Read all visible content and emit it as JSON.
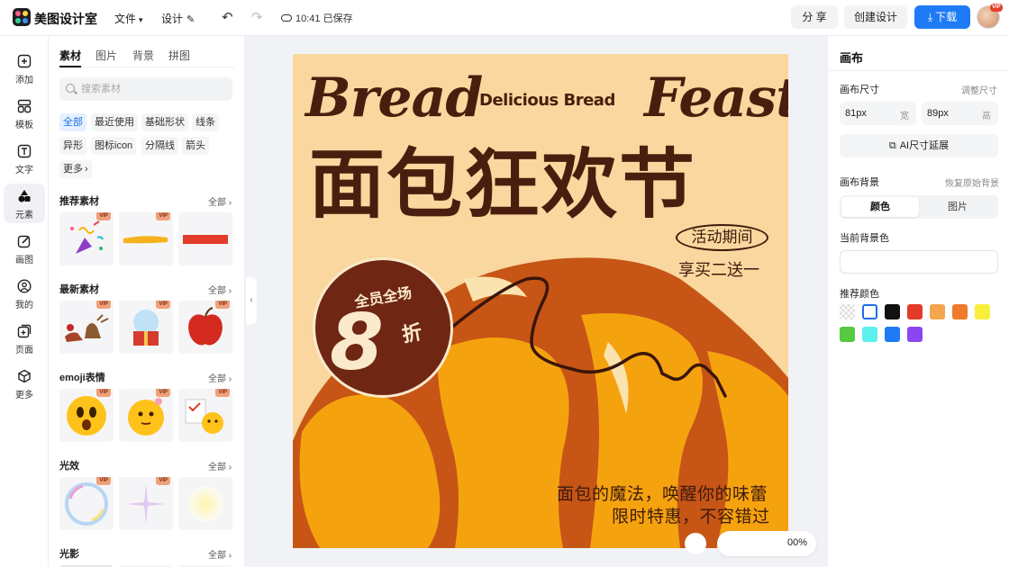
{
  "app": {
    "brand": "美图设计室",
    "save_status": "10:41 已保存"
  },
  "menu": {
    "file": "文件",
    "design": "设计"
  },
  "actions": {
    "share": "分 享",
    "create": "创建设计",
    "download": "下载",
    "avatar_badge": "VIP"
  },
  "rail": [
    {
      "label": "添加",
      "icon": "plus-icon"
    },
    {
      "label": "模板",
      "icon": "template-icon"
    },
    {
      "label": "文字",
      "icon": "text-icon"
    },
    {
      "label": "元素",
      "icon": "element-icon"
    },
    {
      "label": "画图",
      "icon": "draw-icon"
    },
    {
      "label": "我的",
      "icon": "user-icon"
    },
    {
      "label": "页面",
      "icon": "page-icon"
    },
    {
      "label": "更多",
      "icon": "cube-icon"
    }
  ],
  "panel": {
    "tabs": [
      "素材",
      "图片",
      "背景",
      "拼图"
    ],
    "search_placeholder": "搜索素材",
    "chips": [
      "全部",
      "最近使用",
      "基础形状",
      "线条",
      "异形",
      "图标icon",
      "分隔线",
      "箭头",
      "更多"
    ],
    "sections": [
      {
        "title": "推荐素材",
        "all": "全部"
      },
      {
        "title": "最新素材",
        "all": "全部"
      },
      {
        "title": "emoji表情",
        "all": "全部"
      },
      {
        "title": "光效",
        "all": "全部"
      },
      {
        "title": "光影",
        "all": "全部"
      }
    ],
    "vip": "VIP"
  },
  "poster": {
    "bread": "Bread",
    "feast": "Feast",
    "delicious": "Delicious Bread",
    "main_title": "面包狂欢节",
    "period": "活动期间",
    "offer": "享买二送一",
    "badge_top": "全员全场",
    "badge_num": "8",
    "badge_unit": "折",
    "slogan1": "面包的魔法，唤醒你的味蕾",
    "slogan2": "限时特惠，不容错过",
    "colors": {
      "background": "#f9d79e",
      "dark_brown": "#4a1e0e",
      "orange": "#f5a20f",
      "rust": "#c65516"
    }
  },
  "zoom": "00%",
  "right": {
    "title": "画布",
    "size_label": "画布尺寸",
    "adjust_link": "调整尺寸",
    "width_value": "81px",
    "width_unit": "宽",
    "height_value": "89px",
    "height_unit": "高",
    "ai_button": "AI尺寸延展",
    "bg_label": "画布背景",
    "restore_link": "恢复原始背景",
    "seg": [
      "颜色",
      "图片"
    ],
    "current_bg_label": "当前背景色",
    "recommended_label": "推荐颜色",
    "swatches": [
      "transparent",
      "#ffffff",
      "#111111",
      "#e23b2a",
      "#f4a54e",
      "#ee7a2a",
      "#f7ef3c",
      "#55c940",
      "#5ef0ee",
      "#1e7bf5",
      "#8b47ef"
    ]
  }
}
